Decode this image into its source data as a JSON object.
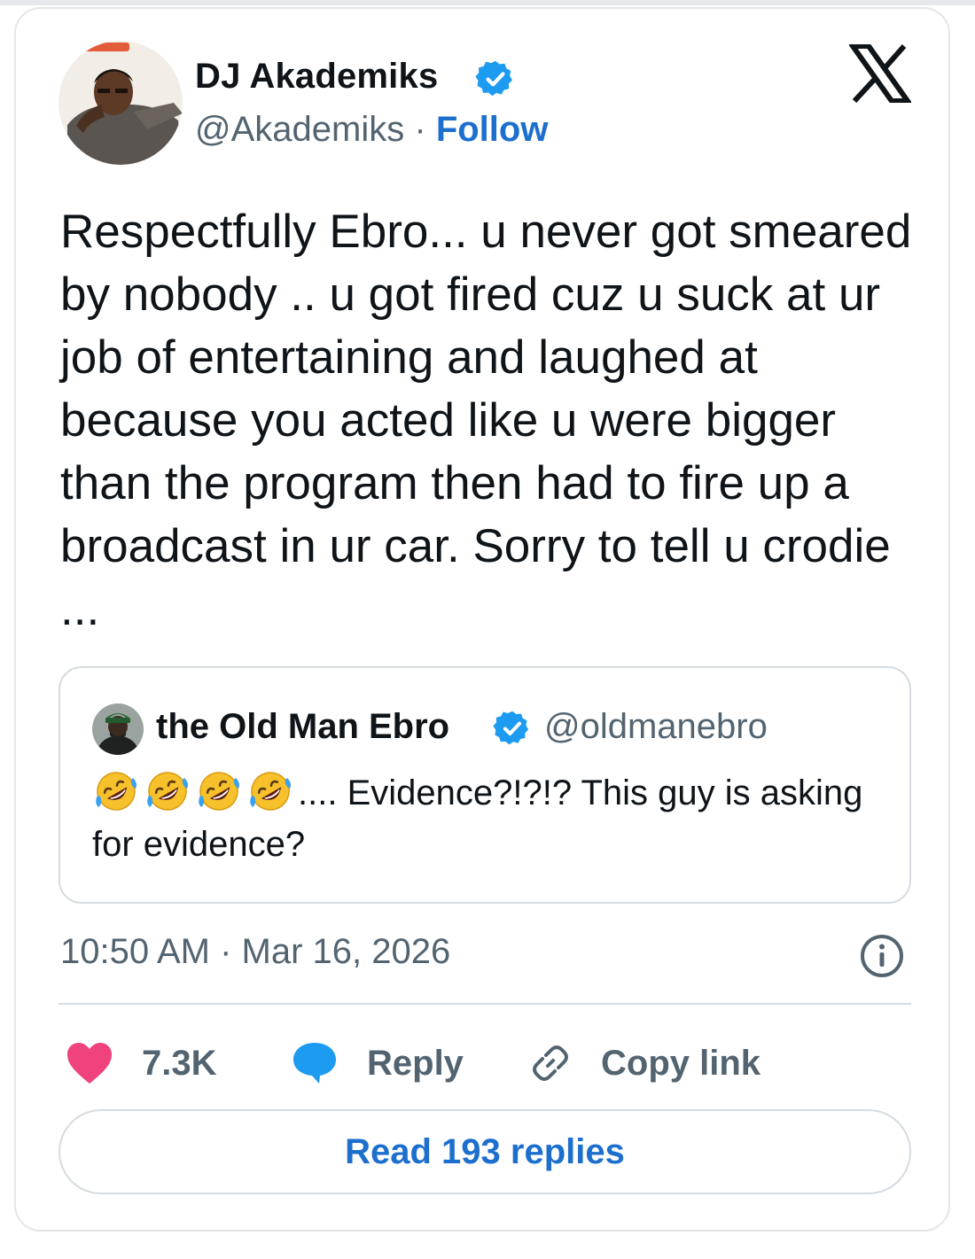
{
  "author": {
    "name": "DJ Akademiks",
    "handle": "@Akademiks",
    "separator": "·",
    "follow": "Follow"
  },
  "tweet": {
    "text": "Respectfully Ebro... u never got smeared by nobody .. u got fired cuz u suck at ur job of entertaining and laughed at because you acted like u were bigger than the program then had to fire up a broadcast in ur car. Sorry to tell u crodie ..."
  },
  "quoted": {
    "name": "the Old Man Ebro",
    "handle": "@oldmanebro",
    "emoji_count": 4,
    "text": ".... Evidence?!?!? This guy is asking for evidence?"
  },
  "meta": {
    "timestamp": "10:50 AM · Mar 16, 2026"
  },
  "actions": {
    "likes": "7.3K",
    "reply": "Reply",
    "copy_link": "Copy link"
  },
  "read_replies": "Read 193 replies",
  "colors": {
    "accent_blue": "#1d6fce",
    "like_pink": "#f0427d",
    "reply_blue": "#1d9bf0",
    "verified_blue": "#1d9bf0",
    "muted_text": "#536471"
  },
  "icons": [
    "verified-badge-icon",
    "x-logo-icon",
    "info-icon",
    "heart-icon",
    "reply-bubble-icon",
    "link-icon",
    "rolling-laughing-emoji"
  ]
}
